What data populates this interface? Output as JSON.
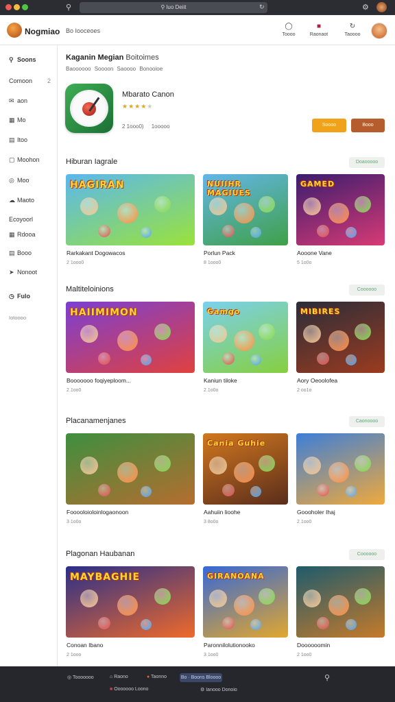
{
  "window": {
    "address": "luo Deiit",
    "traffic_lights": [
      "#ee5b55",
      "#f3bd3f",
      "#4fc447"
    ]
  },
  "header": {
    "brand": "Nogmiao",
    "breadcrumb": "Bo Iooceoes",
    "buttons": [
      {
        "label": "Toooo",
        "icon": "bell-icon"
      },
      {
        "label": "Raonaot",
        "icon": "bag-icon"
      },
      {
        "label": "Taoooo",
        "icon": "refresh-icon"
      }
    ]
  },
  "sidebar": {
    "items": [
      {
        "label": "Soons",
        "icon": "search-icon"
      },
      {
        "label": "Comoon",
        "icon": "",
        "badge": "2"
      },
      {
        "label": "aon",
        "icon": "mail-icon"
      },
      {
        "label": "Mo",
        "icon": "calendar-icon"
      },
      {
        "label": "Itoo",
        "icon": "doc-icon"
      },
      {
        "label": "Moohon",
        "icon": "chat-icon"
      },
      {
        "label": "Moo",
        "icon": "globe-icon"
      },
      {
        "label": "Maoto",
        "icon": "cloud-icon"
      },
      {
        "label": "Ecoyoorl",
        "icon": ""
      },
      {
        "label": "Rdooa",
        "icon": "grid-icon"
      },
      {
        "label": "Booo",
        "icon": "card-icon"
      },
      {
        "label": "Nonoot",
        "icon": "pin-icon"
      },
      {
        "label": "Fulo",
        "icon": "clock-icon"
      },
      {
        "label": "Iotoooo",
        "icon": ""
      }
    ]
  },
  "featured": {
    "title": "Kaganin Megian",
    "title_suffix": "Boitoimes",
    "tabs": [
      "Baoooooo",
      "Soooon",
      "Saoooo",
      "Bonooioe"
    ],
    "app_name": "Mbarato Canon",
    "rating": 4,
    "meta": [
      "2 1ooo0)",
      "1ooooo"
    ],
    "buttons": [
      "Soooo",
      "Booo"
    ],
    "button_colors": [
      "#f0a21a",
      "#b55d2c"
    ]
  },
  "sections": [
    {
      "title": "Hiburan Iagrale",
      "see_all": "Doaooooo",
      "cards": [
        {
          "art_text": "HAGIRAN",
          "name": "Rarkakant Dogowacos",
          "meta": "2 1ooo0",
          "colors": [
            "#5ab8ef",
            "#9ae23a"
          ]
        },
        {
          "art_text": "NUIIHR MAGIUES",
          "name": "Porlun Pack",
          "meta": "8 1ooo0",
          "colors": [
            "#63b6e9",
            "#3fa047"
          ]
        },
        {
          "art_text": "GAMED",
          "name": "Aooone Vane",
          "meta": "5 1o0o",
          "colors": [
            "#3a1d6e",
            "#d83a75"
          ]
        }
      ]
    },
    {
      "title": "Maltiteloinions",
      "see_all": "Coooooo",
      "cards": [
        {
          "art_text": "HAIIMIMON",
          "name": "Booooooo foqiyeploom...",
          "meta": "2 1oo0",
          "colors": [
            "#7b3fd3",
            "#e0413e"
          ]
        },
        {
          "art_text": "Gamgo",
          "name": "Kaniun tiloke",
          "meta": "2 1o0o",
          "colors": [
            "#7ad1ee",
            "#86cf3e"
          ]
        },
        {
          "art_text": "MIBIRES",
          "name": "Aory Oeoolofea",
          "meta": "2 oo1o",
          "colors": [
            "#2a2d3a",
            "#9c3b1f"
          ]
        }
      ]
    },
    {
      "title": "Placanamenjanes",
      "see_all": "Caonoooo",
      "cards": [
        {
          "art_text": "",
          "name": "Fooooloioloinlogaonoon",
          "meta": "3 1o0o",
          "colors": [
            "#3e8f3f",
            "#b56d2f"
          ]
        },
        {
          "art_text": "Cania Guhie",
          "name": "Aahuiin lioohe",
          "meta": "3 8o0o",
          "colors": [
            "#d1781f",
            "#5a2d1b"
          ]
        },
        {
          "art_text": "",
          "name": "Goooholer Ihaj",
          "meta": "2 1oo0",
          "colors": [
            "#3d7fd8",
            "#f0a93b"
          ]
        }
      ]
    },
    {
      "title": "Plagonan Haubanan",
      "see_all": "Coooooo",
      "cards": [
        {
          "art_text": "MAYBAGHIE",
          "name": "Conoan Ibano",
          "meta": "2 1ooo",
          "colors": [
            "#2a2f8a",
            "#ef6a2a"
          ]
        },
        {
          "art_text": "GIRANOANA",
          "name": "Paronnilolutionooko",
          "meta": "3 1oo0",
          "colors": [
            "#3568d8",
            "#e2a72c"
          ]
        },
        {
          "art_text": "",
          "name": "Doooooomin",
          "meta": "2 1oo0",
          "colors": [
            "#1f5b6c",
            "#c57a2a"
          ]
        }
      ]
    }
  ],
  "footer": {
    "items": [
      {
        "label": "Tooooooo",
        "icon": "globe-icon"
      },
      {
        "label": "Raono",
        "icon": "home-icon"
      },
      {
        "label": "Taonno",
        "icon": "fire-icon"
      },
      {
        "label": "Ooooooo Loono",
        "icon": "bag-icon"
      },
      {
        "label": "Ianooo Donoio",
        "icon": "gear-icon"
      }
    ],
    "pill": "Bo · Boons Bloooo"
  }
}
